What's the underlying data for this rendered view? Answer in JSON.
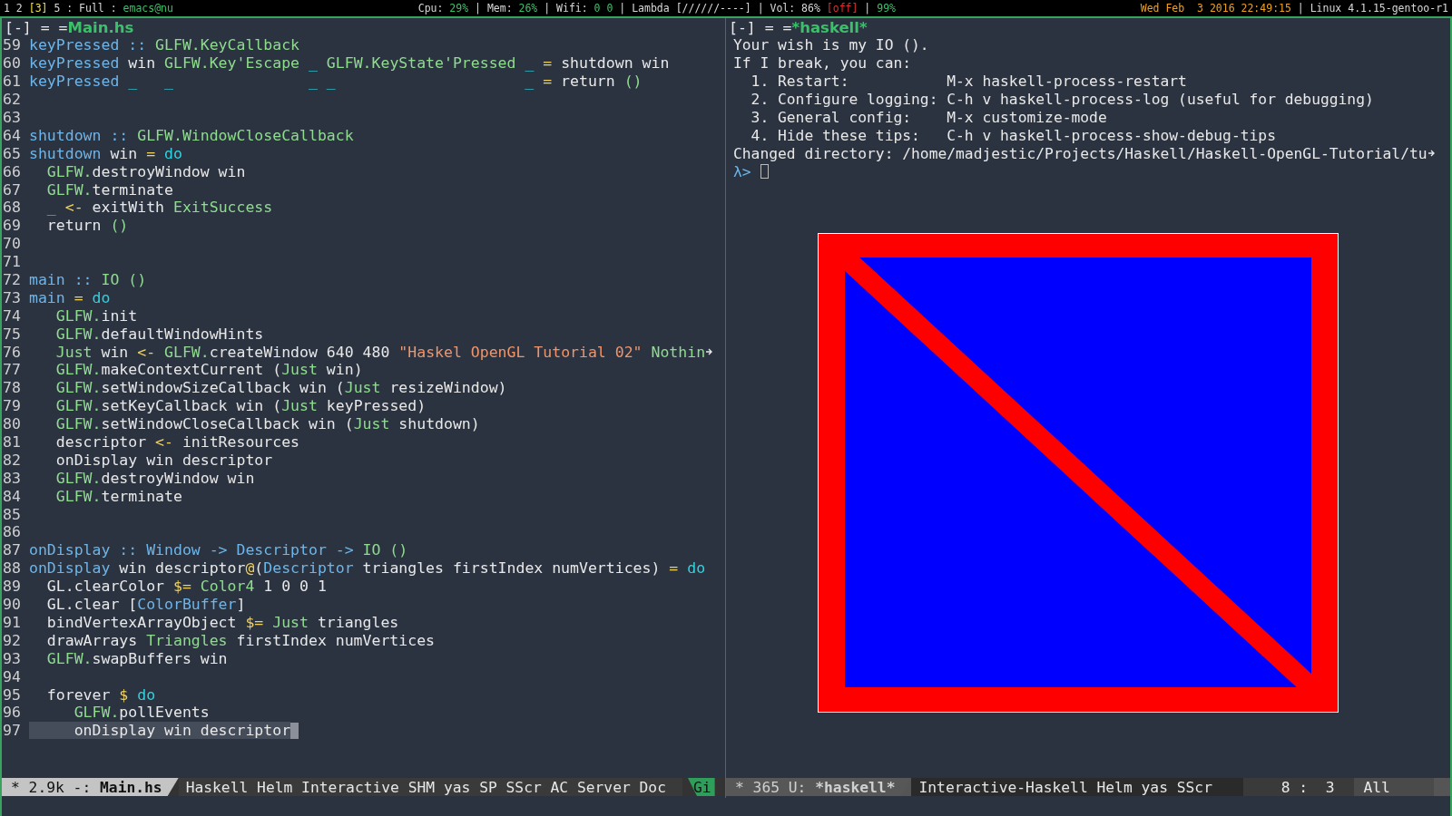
{
  "top_bar": {
    "workspaces": [
      {
        "text": "1 2 ",
        "kind": "plain"
      },
      {
        "text": "[3]",
        "kind": "current"
      },
      {
        "text": " 5 : Full : ",
        "kind": "plain"
      },
      {
        "text": "emacs@nu",
        "kind": "host"
      }
    ],
    "system": [
      {
        "text": "Cpu: ",
        "kind": "plain"
      },
      {
        "text": "29%",
        "kind": "good"
      },
      {
        "text": " | Mem: ",
        "kind": "plain"
      },
      {
        "text": "26%",
        "kind": "good"
      },
      {
        "text": " | Wifi: ",
        "kind": "plain"
      },
      {
        "text": "0 0",
        "kind": "good"
      },
      {
        "text": " | Lambda [//////----] | Vol: 86% ",
        "kind": "plain"
      },
      {
        "text": "[off]",
        "kind": "alert"
      },
      {
        "text": " | ",
        "kind": "plain"
      },
      {
        "text": "99%",
        "kind": "good"
      }
    ],
    "clock": [
      {
        "text": "Wed Feb  3 2016 22:49:15",
        "kind": "clock"
      },
      {
        "text": " | Linux 4.1.15-gentoo-r1",
        "kind": "plain"
      }
    ]
  },
  "editor": {
    "header": {
      "prefix": "[-] = =",
      "buffer": "Main.hs"
    },
    "lines": [
      {
        "number": "59",
        "tokens": [
          {
            "kind": "name",
            "text": "keyPressed :: "
          },
          {
            "kind": "type",
            "text": "GLFW.KeyCallback"
          }
        ]
      },
      {
        "number": "60",
        "tokens": [
          {
            "kind": "name",
            "text": "keyPressed"
          },
          {
            "kind": "plain",
            "text": " win "
          },
          {
            "kind": "type",
            "text": "GLFW.Key'Escape"
          },
          {
            "kind": "keyword",
            "text": " _"
          },
          {
            "kind": "type",
            "text": " GLFW.KeyState'Pressed"
          },
          {
            "kind": "keyword",
            "text": " _"
          },
          {
            "kind": "operator",
            "text": " ="
          },
          {
            "kind": "plain",
            "text": " shutdown win"
          }
        ]
      },
      {
        "number": "61",
        "tokens": [
          {
            "kind": "name",
            "text": "keyPressed "
          },
          {
            "kind": "keyword",
            "text": "_   _               _ _                     _"
          },
          {
            "kind": "operator",
            "text": " ="
          },
          {
            "kind": "plain",
            "text": " return "
          },
          {
            "kind": "type",
            "text": "()"
          }
        ]
      },
      {
        "number": "62"
      },
      {
        "number": "63"
      },
      {
        "number": "64",
        "tokens": [
          {
            "kind": "name",
            "text": "shutdown :: "
          },
          {
            "kind": "type",
            "text": "GLFW.WindowCloseCallback"
          }
        ]
      },
      {
        "number": "65",
        "tokens": [
          {
            "kind": "name",
            "text": "shutdown"
          },
          {
            "kind": "plain",
            "text": " win "
          },
          {
            "kind": "operator",
            "text": "="
          },
          {
            "kind": "keyword",
            "text": " do"
          }
        ]
      },
      {
        "number": "66",
        "tokens": [
          {
            "kind": "type",
            "text": "  GLFW."
          },
          {
            "kind": "plain",
            "text": "destroyWindow win"
          }
        ]
      },
      {
        "number": "67",
        "tokens": [
          {
            "kind": "type",
            "text": "  GLFW."
          },
          {
            "kind": "plain",
            "text": "terminate"
          }
        ]
      },
      {
        "number": "68",
        "tokens": [
          {
            "kind": "keyword",
            "text": "  _"
          },
          {
            "kind": "operator",
            "text": " <-"
          },
          {
            "kind": "plain",
            "text": " exitWith "
          },
          {
            "kind": "type",
            "text": "ExitSuccess"
          }
        ]
      },
      {
        "number": "69",
        "tokens": [
          {
            "kind": "plain",
            "text": "  return "
          },
          {
            "kind": "type",
            "text": "()"
          }
        ]
      },
      {
        "number": "70"
      },
      {
        "number": "71"
      },
      {
        "number": "72",
        "tokens": [
          {
            "kind": "name",
            "text": "main :: "
          },
          {
            "kind": "type",
            "text": "IO ()"
          }
        ]
      },
      {
        "number": "73",
        "tokens": [
          {
            "kind": "name",
            "text": "main"
          },
          {
            "kind": "operator",
            "text": " ="
          },
          {
            "kind": "keyword",
            "text": " do"
          }
        ]
      },
      {
        "number": "74",
        "tokens": [
          {
            "kind": "type",
            "text": "   GLFW."
          },
          {
            "kind": "plain",
            "text": "init"
          }
        ]
      },
      {
        "number": "75",
        "tokens": [
          {
            "kind": "type",
            "text": "   GLFW."
          },
          {
            "kind": "plain",
            "text": "defaultWindowHints"
          }
        ]
      },
      {
        "number": "76",
        "continued": true,
        "tokens": [
          {
            "kind": "type",
            "text": "   Just"
          },
          {
            "kind": "plain",
            "text": " win "
          },
          {
            "kind": "operator",
            "text": "<-"
          },
          {
            "kind": "type",
            "text": " GLFW."
          },
          {
            "kind": "plain",
            "text": "createWindow 640 480 "
          },
          {
            "kind": "string",
            "text": "\"Haskel OpenGL Tutorial 02\""
          },
          {
            "kind": "type",
            "text": " Nothin"
          }
        ]
      },
      {
        "number": "77",
        "tokens": [
          {
            "kind": "type",
            "text": "   GLFW."
          },
          {
            "kind": "plain",
            "text": "makeContextCurrent ("
          },
          {
            "kind": "type",
            "text": "Just"
          },
          {
            "kind": "plain",
            "text": " win)"
          }
        ]
      },
      {
        "number": "78",
        "tokens": [
          {
            "kind": "type",
            "text": "   GLFW."
          },
          {
            "kind": "plain",
            "text": "setWindowSizeCallback win ("
          },
          {
            "kind": "type",
            "text": "Just"
          },
          {
            "kind": "plain",
            "text": " resizeWindow)"
          }
        ]
      },
      {
        "number": "79",
        "tokens": [
          {
            "kind": "type",
            "text": "   GLFW."
          },
          {
            "kind": "plain",
            "text": "setKeyCallback win ("
          },
          {
            "kind": "type",
            "text": "Just"
          },
          {
            "kind": "plain",
            "text": " keyPressed)"
          }
        ]
      },
      {
        "number": "80",
        "tokens": [
          {
            "kind": "type",
            "text": "   GLFW."
          },
          {
            "kind": "plain",
            "text": "setWindowCloseCallback win ("
          },
          {
            "kind": "type",
            "text": "Just"
          },
          {
            "kind": "plain",
            "text": " shutdown)"
          }
        ]
      },
      {
        "number": "81",
        "tokens": [
          {
            "kind": "plain",
            "text": "   descriptor "
          },
          {
            "kind": "operator",
            "text": "<-"
          },
          {
            "kind": "plain",
            "text": " initResources"
          }
        ]
      },
      {
        "number": "82",
        "tokens": [
          {
            "kind": "plain",
            "text": "   onDisplay win descriptor"
          }
        ]
      },
      {
        "number": "83",
        "tokens": [
          {
            "kind": "type",
            "text": "   GLFW."
          },
          {
            "kind": "plain",
            "text": "destroyWindow win"
          }
        ]
      },
      {
        "number": "84",
        "tokens": [
          {
            "kind": "type",
            "text": "   GLFW."
          },
          {
            "kind": "plain",
            "text": "terminate"
          }
        ]
      },
      {
        "number": "85"
      },
      {
        "number": "86"
      },
      {
        "number": "87",
        "tokens": [
          {
            "kind": "name",
            "text": "onDisplay :: Window -> Descriptor -> "
          },
          {
            "kind": "type",
            "text": "IO ()"
          }
        ]
      },
      {
        "number": "88",
        "tokens": [
          {
            "kind": "name",
            "text": "onDisplay"
          },
          {
            "kind": "plain",
            "text": " win descriptor"
          },
          {
            "kind": "operator",
            "text": "@"
          },
          {
            "kind": "plain",
            "text": "("
          },
          {
            "kind": "name",
            "text": "Descriptor"
          },
          {
            "kind": "plain",
            "text": " triangles firstIndex numVertices) "
          },
          {
            "kind": "operator",
            "text": "="
          },
          {
            "kind": "keyword",
            "text": " do"
          }
        ]
      },
      {
        "number": "89",
        "tokens": [
          {
            "kind": "plain",
            "text": "  GL.clearColor "
          },
          {
            "kind": "operator",
            "text": "$="
          },
          {
            "kind": "type",
            "text": " Color4"
          },
          {
            "kind": "plain",
            "text": " 1 0 0 1"
          }
        ]
      },
      {
        "number": "90",
        "tokens": [
          {
            "kind": "plain",
            "text": "  GL.clear ["
          },
          {
            "kind": "name",
            "text": "ColorBuffer"
          },
          {
            "kind": "plain",
            "text": "]"
          }
        ]
      },
      {
        "number": "91",
        "tokens": [
          {
            "kind": "plain",
            "text": "  bindVertexArrayObject "
          },
          {
            "kind": "operator",
            "text": "$="
          },
          {
            "kind": "type",
            "text": " Just"
          },
          {
            "kind": "plain",
            "text": " triangles"
          }
        ]
      },
      {
        "number": "92",
        "tokens": [
          {
            "kind": "plain",
            "text": "  drawArrays "
          },
          {
            "kind": "type",
            "text": "Triangles"
          },
          {
            "kind": "plain",
            "text": " firstIndex numVertices"
          }
        ]
      },
      {
        "number": "93",
        "tokens": [
          {
            "kind": "type",
            "text": "  GLFW."
          },
          {
            "kind": "plain",
            "text": "swapBuffers win"
          }
        ]
      },
      {
        "number": "94"
      },
      {
        "number": "95",
        "tokens": [
          {
            "kind": "plain",
            "text": "  forever "
          },
          {
            "kind": "operator",
            "text": "$"
          },
          {
            "kind": "keyword",
            "text": " do"
          }
        ]
      },
      {
        "number": "96",
        "tokens": [
          {
            "kind": "type",
            "text": "     GLFW."
          },
          {
            "kind": "plain",
            "text": "pollEvents"
          }
        ]
      },
      {
        "number": "97",
        "current": true,
        "cursor": true,
        "tokens": [
          {
            "kind": "plain",
            "text": "     onDisplay win descriptor"
          }
        ]
      }
    ],
    "mode_line": {
      "active": true,
      "segments": [
        {
          "kind": "buffer",
          "text": "* 2.9k -: ",
          "buffer": "Main.hs"
        },
        {
          "kind": "modes",
          "text": "Haskell Helm Interactive SHM yas SP SScr AC Server Doc"
        },
        {
          "kind": "vcs",
          "text": "Gi"
        }
      ]
    }
  },
  "repl": {
    "header": {
      "prefix": "[-] = =",
      "buffer": "*haskell*"
    },
    "output": [
      {
        "text": "Your wish is my IO ()."
      },
      {
        "text": "If I break, you can:"
      },
      {
        "text": "  1. Restart:           M-x haskell-process-restart"
      },
      {
        "text": "  2. Configure logging: C-h v haskell-process-log (useful for debugging)"
      },
      {
        "text": "  3. General config:    M-x customize-mode"
      },
      {
        "text": "  4. Hide these tips:   C-h v haskell-process-show-debug-tips"
      },
      {
        "text": "Changed directory: /home/madjestic/Projects/Haskell/Haskell-OpenGL-Tutorial/tu",
        "continued": true
      }
    ],
    "prompt": "λ>",
    "cursor": true,
    "mode_line": {
      "active": false,
      "segments": [
        {
          "kind": "buffer",
          "text": "* 365 U: ",
          "buffer": "*haskell*"
        },
        {
          "kind": "modes",
          "text": "Interactive-Haskell Helm yas SScr"
        },
        {
          "kind": "position",
          "text": "8 :  3"
        },
        {
          "kind": "extent",
          "text": "All"
        }
      ]
    }
  }
}
